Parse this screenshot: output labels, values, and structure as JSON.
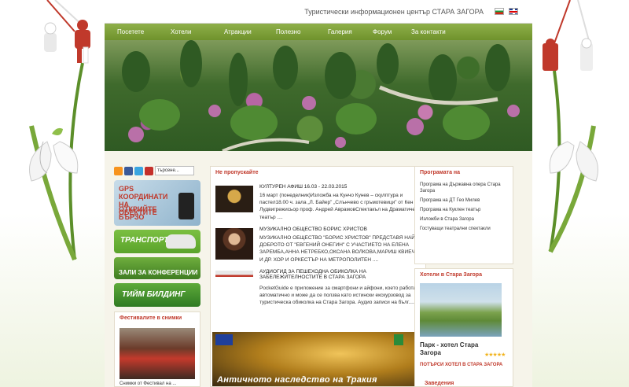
{
  "header": {
    "site_title": "Туристически информационен център СТАРА ЗАГОРА",
    "lang_bg": "BG",
    "lang_en": "EN"
  },
  "nav": [
    {
      "label": "Посетете"
    },
    {
      "label": "Хотели"
    },
    {
      "label": "Атракции"
    },
    {
      "label": "Полезно"
    },
    {
      "label": "Галерия"
    },
    {
      "label": "Форум"
    },
    {
      "label": "За контакти"
    }
  ],
  "search": {
    "placeholder": "търсене..."
  },
  "promos": {
    "gps_line1": "GPS КООРДИНАТИ НА ОБЕКТИТЕ",
    "gps_line2": "ОТКРИЙТЕ БЪРЗО",
    "transport": "ТРАНСПОРТ",
    "conference": "ЗАЛИ ЗА КОНФЕРЕНЦИИ",
    "team": "ТИЙМ БИЛДИНГ"
  },
  "festivals": {
    "title": "Фестивалите в снимки",
    "caption": "Снимки от Фестивал на ..."
  },
  "news": {
    "section_title": "Не пропускайте",
    "items": [
      {
        "title": "КУЛТУРЕН АФИШ 16.03 - 22.03.2015",
        "text": "16 март (понеделник)Изложба на Кунчо Кунев – скулптура и пастел18.00 ч. зала „Л. Байер” „Слънчево с гръмотевици” от Кен Лудвигрежисьор проф. Андрей АврамовСпектакъл на Драматичен театър ...."
      },
      {
        "title": "МУЗИКАЛНО ОБЩЕСТВО БОРИС ХРИСТОВ",
        "text": "МУЗИКАЛНО ОБЩЕСТВО \"БОРИС ХРИСТОВ\" ПРЕДСТАВЯ НАЙ-ДОБРОТО ОТ \"ЕВГЕНИЙ ОНЕГИН\" С УЧАСТИЕТО НА ЕЛЕНА ЗАРЕМБА,АННА НЕТРЕБКО,ОКСАНА ВОЛКОВА,МАРИШ КВИЕЧИЕН И ДР. ХОР И ОРКЕСТЪР НА МЕТРОПОЛИТЕН ...."
      },
      {
        "title": "АУДИОГИД ЗА ПЕШЕХОДНА ОБИКОЛКА НА ЗАБЕЛЕЖИТЕЛНОСТИТЕ В СТАРА ЗАГОРА",
        "text": "PocketGuide е приложение за смартфони и айфони, което работи автоматично и може да се ползва като истински екскурзовод за туристическа обиколка на Стара Загора. Аудио записи на бълг...."
      }
    ]
  },
  "bottom_banner": {
    "title": "Античното наследство на Тракия"
  },
  "programs": {
    "title": "Програмата на",
    "items": [
      "Програма на Държавна опера Стара Загора",
      "Програма на ДТ Гео Милев",
      "Програма на Куклен театър",
      "Изложби в Стара Загора",
      "Гостуващи театрални спектакли"
    ]
  },
  "hotels": {
    "title": "Хотели в Стара Загора",
    "featured_name": "Парк - хотел Стара Загора",
    "stars": "★★★★★",
    "search_link": "ПОТЪРСИ ХОТЕЛ В СТАРА ЗАГОРА",
    "next_section": "Заведения"
  }
}
